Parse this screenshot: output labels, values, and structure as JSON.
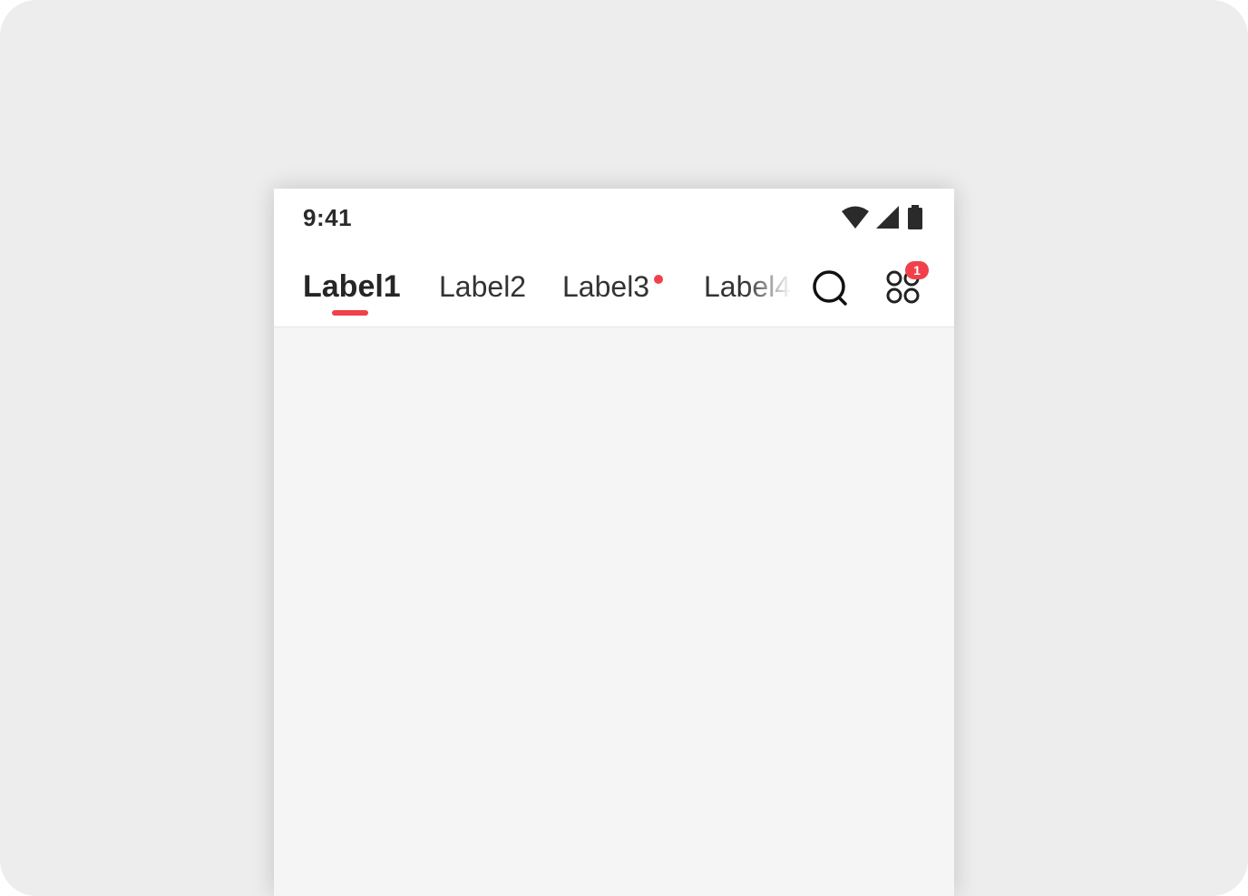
{
  "status_bar": {
    "time": "9:41",
    "icons": [
      "wifi-icon",
      "cellular-signal-icon",
      "battery-icon"
    ]
  },
  "tabs": [
    {
      "label": "Label1",
      "active": true,
      "dot": false
    },
    {
      "label": "Label2",
      "active": false,
      "dot": false
    },
    {
      "label": "Label3",
      "active": false,
      "dot": true
    },
    {
      "label": "Label4",
      "active": false,
      "dot": false
    }
  ],
  "actions": {
    "search_icon": "search-icon",
    "apps_icon": "apps-grid-icon",
    "apps_badge": "1"
  },
  "colors": {
    "accent": "#f0414a",
    "text": "#333333",
    "background": "#ededed",
    "page_background": "#f5f5f5"
  }
}
